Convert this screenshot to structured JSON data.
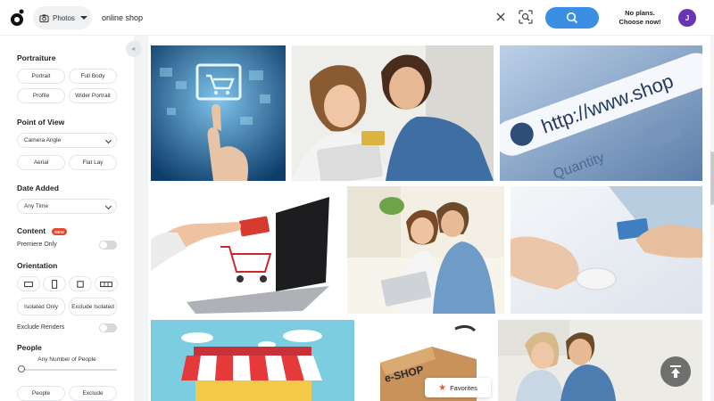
{
  "topbar": {
    "type_label": "Photos",
    "search_value": "online shop",
    "plans_line1": "No plans.",
    "plans_line2": "Choose now!",
    "avatar_letter": "J",
    "accent_color": "#3a8fe3",
    "avatar_color": "#6a35b5"
  },
  "sidebar": {
    "collapse_icon": "double-chevron-left-icon",
    "portraiture": {
      "title": "Portraiture",
      "options": [
        "Portrait",
        "Full Body",
        "Profile",
        "Wider Portrait"
      ]
    },
    "point_of_view": {
      "title": "Point of View",
      "select_value": "Camera Angle",
      "options": [
        "Aerial",
        "Flat Lay"
      ]
    },
    "date_added": {
      "title": "Date Added",
      "select_value": "Any Time"
    },
    "content": {
      "title": "Content",
      "badge": "NEW",
      "toggle_label": "Premiere Only",
      "toggle_on": false
    },
    "orientation": {
      "title": "Orientation",
      "icons": [
        "landscape-icon",
        "portrait-icon",
        "square-icon",
        "panoramic-icon"
      ],
      "isolated_only": "Isolated Only",
      "exclude_isolated": "Exclude Isolated",
      "exclude_renders": "Exclude Renders",
      "exclude_renders_on": false
    },
    "people": {
      "title": "People",
      "slider_label": "Any Number of People",
      "options": [
        "People",
        "Exclude"
      ]
    }
  },
  "results": {
    "images": [
      "touchscreen-shopping-cart-photo",
      "couple-tablet-credit-card-photo",
      "http-www-shop-address-bar-photo",
      "laptop-credit-card-cart-photo",
      "couple-sofa-laptop-photo",
      "hand-mouse-credit-card-photo",
      "shop-awning-illustration",
      "e-shop-box-cart-photo",
      "couple-laptop-photo"
    ],
    "url_text": "http://www.shop",
    "quantity_text": "Quantity",
    "eshop_text": "e-SHOP"
  },
  "favorites": {
    "label": "Favorites",
    "icon": "star-icon"
  },
  "back_to_top_icon": "arrow-up-to-top-icon"
}
